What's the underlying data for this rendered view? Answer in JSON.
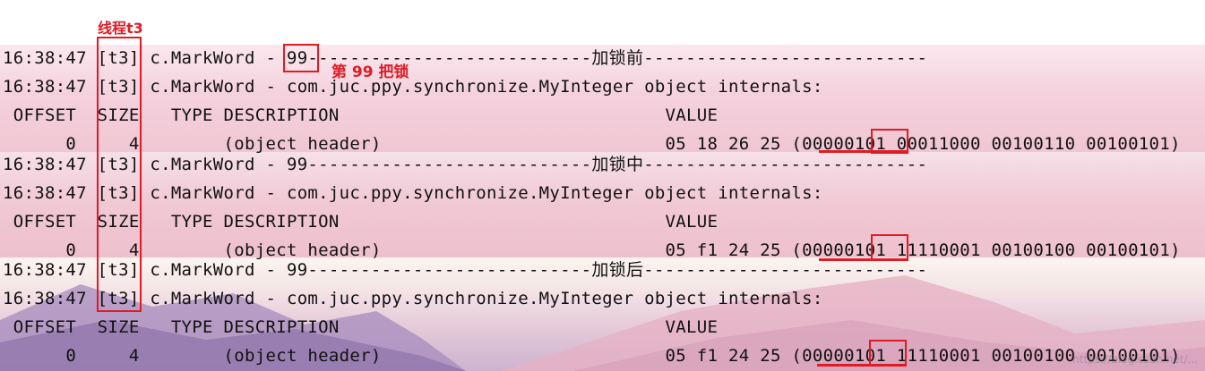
{
  "annotations": {
    "thread_label": "线程t3",
    "lock_note": "第 99 把锁"
  },
  "sections": [
    {
      "name": "before",
      "lines": [
        "16:38:47 [t3] c.MarkWord - 99---------------------------加锁前---------------------------",
        "16:38:47 [t3] c.MarkWord - com.juc.ppy.synchronize.MyInteger object internals:",
        " OFFSET  SIZE   TYPE DESCRIPTION                               VALUE",
        "      0     4        (object header)                           05 18 26 25 (00000101 00011000 00100110 00100101)"
      ]
    },
    {
      "name": "during",
      "lines": [
        "16:38:47 [t3] c.MarkWord - 99---------------------------加锁中---------------------------",
        "16:38:47 [t3] c.MarkWord - com.juc.ppy.synchronize.MyInteger object internals:",
        " OFFSET  SIZE   TYPE DESCRIPTION                               VALUE",
        "      0     4        (object header)                           05 f1 24 25 (00000101 11110001 00100100 00100101)"
      ]
    },
    {
      "name": "after",
      "lines": [
        "16:38:47 [t3] c.MarkWord - 99---------------------------加锁后---------------------------",
        "16:38:47 [t3] c.MarkWord - com.juc.ppy.synchronize.MyInteger object internals:",
        " OFFSET  SIZE   TYPE DESCRIPTION                               VALUE",
        "      0     4        (object header)                           05 f1 24 25 (00000101 11110001 00100100 00100101)"
      ]
    }
  ],
  "watermark": "https://blog.csdn.net/...",
  "colors": {
    "annotation": "#e01b24"
  }
}
